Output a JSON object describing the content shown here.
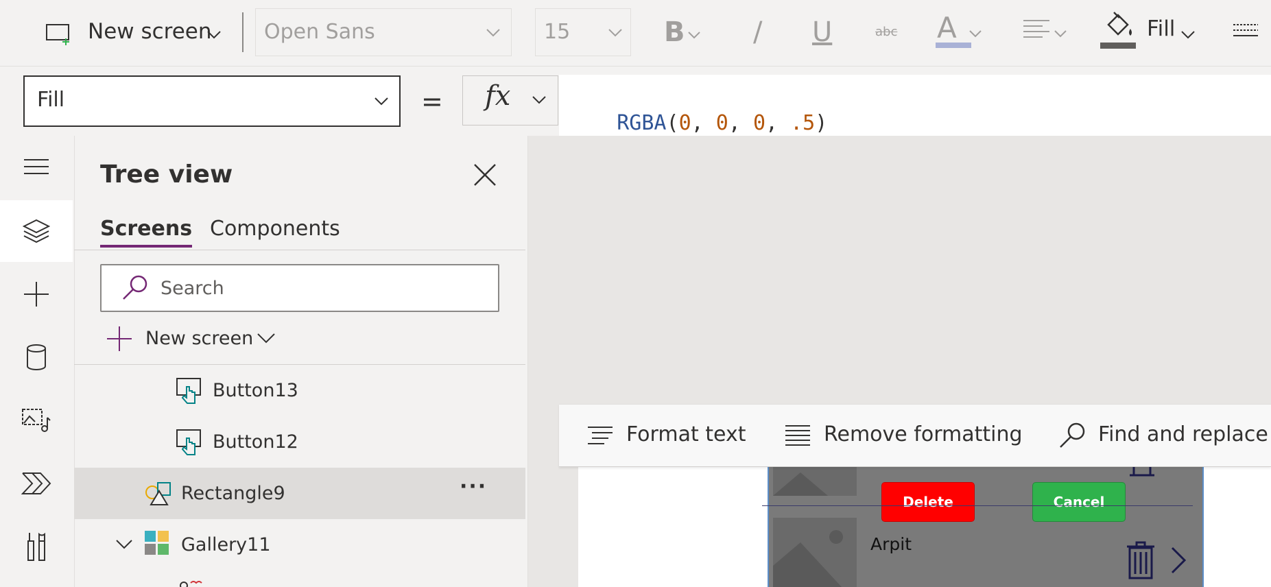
{
  "ribbon": {
    "new_screen_label": "New screen",
    "font_name": "Open Sans",
    "font_size": "15",
    "bold_glyph": "B",
    "italic_glyph": "/",
    "underline_glyph": "U",
    "strike_glyph": "abc",
    "font_color_glyph": "A",
    "fill_label": "Fill"
  },
  "formula": {
    "property": "Fill",
    "equals": "=",
    "fx": "fx",
    "fn_name": "RGBA",
    "open_paren": "(",
    "arg1": "0",
    "arg2": "0",
    "arg3": "0",
    "arg4": ".5",
    "comma": ", ",
    "close_paren": ")"
  },
  "editor_toolbar": {
    "format_text": "Format text",
    "remove_formatting": "Remove formatting",
    "find_replace": "Find and replace"
  },
  "tree": {
    "title": "Tree view",
    "tabs": [
      "Screens",
      "Components"
    ],
    "search_placeholder": "Search",
    "new_screen": "New screen",
    "items": [
      {
        "label": "Button13"
      },
      {
        "label": "Button12"
      },
      {
        "label": "Rectangle9"
      },
      {
        "label": "Gallery11"
      }
    ],
    "more_glyph": "···"
  },
  "app": {
    "delete_label": "Delete",
    "cancel_label": "Cancel",
    "row_name": "Arpit"
  },
  "colors": {
    "accent_purple": "#742774",
    "teal_icon": "#038387",
    "delete_red": "#ff0000",
    "cancel_green": "#2fb24c",
    "code_blue": "#2f5496",
    "code_orange": "#b4560a"
  }
}
